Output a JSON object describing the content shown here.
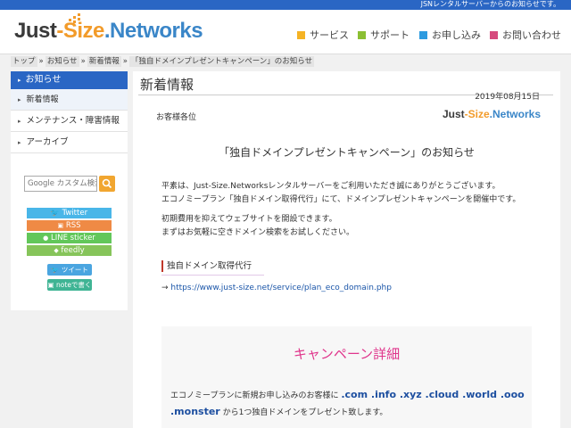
{
  "topbar": {
    "text": "JSNレンタルサーバーからのお知らせです。"
  },
  "logo": {
    "part1": "Just",
    "dash": "-",
    "part2": "Size",
    "part3": ".Networks"
  },
  "gnav": [
    {
      "label": "サービス",
      "color": "#f5b324"
    },
    {
      "label": "サポート",
      "color": "#8bbf33"
    },
    {
      "label": "お申し込み",
      "color": "#2d9be0"
    },
    {
      "label": "お問い合わせ",
      "color": "#d64a7d"
    }
  ],
  "breadcrumb": [
    "トップ",
    "お知らせ",
    "新着情報",
    "「独自ドメインプレゼントキャンペーン」のお知らせ"
  ],
  "breadcrumb_sep": "»",
  "sidebar": {
    "header": "お知らせ",
    "items": [
      {
        "label": "新着情報"
      },
      {
        "label": "メンテナンス・障害情報"
      },
      {
        "label": "アーカイブ"
      }
    ],
    "search_placeholder": "Google カスタム検索",
    "social": [
      {
        "label": "Twitter",
        "color": "#49b6e8"
      },
      {
        "label": "RSS",
        "color": "#ef8a45"
      },
      {
        "label": "LINE sticker",
        "color": "#62c75a"
      },
      {
        "label": "feedly",
        "color": "#86c45a"
      }
    ],
    "tweet_label": "ツイート",
    "note_label": "noteで書く"
  },
  "main": {
    "title": "新着情報",
    "date": "2019年08月15日",
    "addressee": "お客様各位",
    "mini_logo": {
      "part1": "Just",
      "dash": "-",
      "part2": "Size",
      "part3": ".Networks"
    },
    "notice_title": "「独自ドメインプレゼントキャンペーン」のお知らせ",
    "para1": "平素は、Just-Size.Networksレンタルサーバーをご利用いただき誠にありがとうございます。",
    "para2": "エコノミープラン「独自ドメイン取得代行」にて、ドメインプレゼントキャンペーンを開催中です。",
    "para3": "初期費用を抑えてウェブサイトを開設できます。",
    "para4": "まずはお気軽に空きドメイン検索をお試しください。",
    "subhead": "独自ドメイン取得代行",
    "link_arrow": "→",
    "link_url": "https://www.just-size.net/service/plan_eco_domain.php",
    "campaign_title": "キャンペーン詳細",
    "campaign_line1_pre": "エコノミープランに新規お申し込みのお客様に",
    "campaign_tlds": ".com .info .xyz .cloud .world .ooo",
    "campaign_tld2": ".monster",
    "campaign_line2_post": "から1つ独自ドメインをプレゼント致します。"
  }
}
